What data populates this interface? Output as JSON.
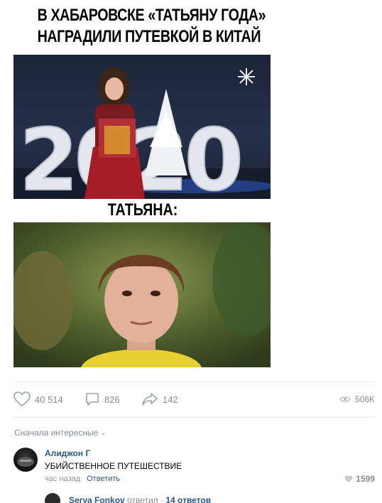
{
  "meme": {
    "title_line1": "В ХАБАРОВСКЕ «ТАТЬЯНУ ГОДА»",
    "title_line2": "НАГРАДИЛИ ПУТЕВКОЙ В КИТАЙ",
    "year_sign": "2020",
    "caption": "ТАТЬЯНА:"
  },
  "post_actions": {
    "likes": "40 514",
    "comments": "826",
    "shares": "142",
    "views": "506K",
    "icons": [
      "heart-icon",
      "comment-icon",
      "share-icon",
      "eye-icon"
    ]
  },
  "comments_section": {
    "sort_label": "Сначала интересные",
    "comment": {
      "author": "Алиджон Г",
      "text": "УБИЙСТВЕННОЕ ПУТЕШЕСТВИЕ",
      "time": "час назад",
      "reply_label": "Ответить",
      "likes": "1599"
    },
    "thread": {
      "author": "Serya Fonkov",
      "action": "ответил",
      "replies": "14 ответов"
    }
  },
  "colors": {
    "link": "#2a5885",
    "muted": "#818c99",
    "divider": "#e7e8ec"
  }
}
